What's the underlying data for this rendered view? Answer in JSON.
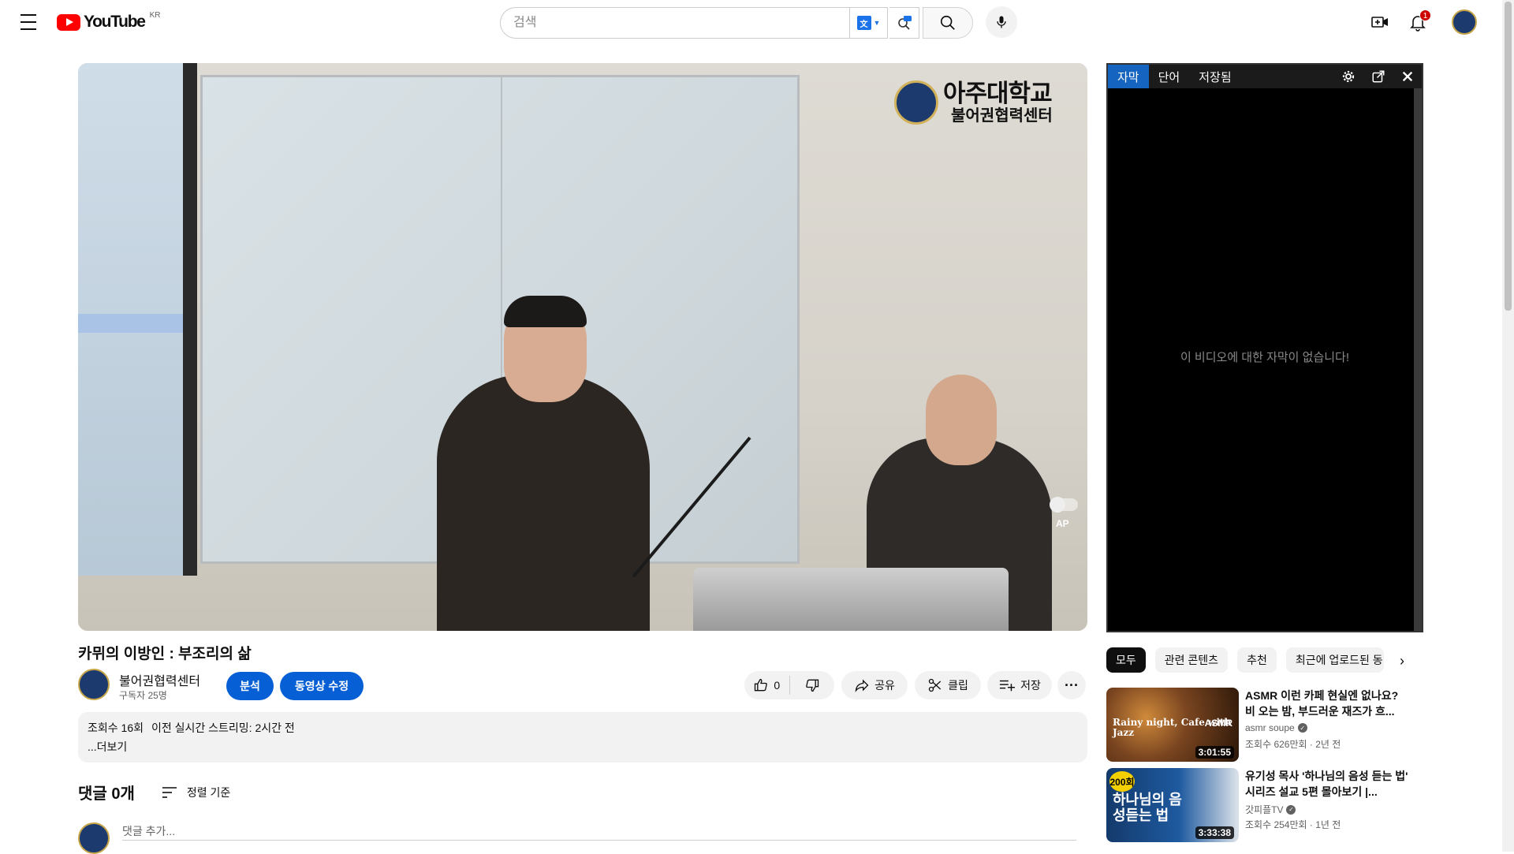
{
  "header": {
    "logo_text": "YouTube",
    "region": "KR",
    "search_placeholder": "검색",
    "notification_count": "1"
  },
  "player": {
    "brand_line1": "아주대학교",
    "brand_line2": "불어권협력센터",
    "autoplay_label": "AP"
  },
  "video": {
    "title": "카뮈의 이방인 : 부조리의 삶",
    "channel_name": "불어권협력센터",
    "subscribers": "구독자 25명",
    "analytics_label": "분석",
    "edit_label": "동영상 수정",
    "like_count": "0",
    "share_label": "공유",
    "clip_label": "클립",
    "save_label": "저장",
    "views": "조회수 16회",
    "stream_info": "이전 실시간 스트리밍: 2시간 전",
    "more_label": "...더보기"
  },
  "comments": {
    "count_label": "댓글 0개",
    "sort_label": "정렬 기준",
    "add_placeholder": "댓글 추가..."
  },
  "subtitle_panel": {
    "tabs": [
      "자막",
      "단어",
      "저장됨"
    ],
    "empty_message": "이 비디오에 대한 자막이 없습니다!"
  },
  "chips": [
    "모두",
    "관련 콘텐츠",
    "추천",
    "최근에 업로드된 동"
  ],
  "related": [
    {
      "title": "ASMR 이런 카페 현실엔 없나요? 비 오는 밤, 부드러운 재즈가 흐...",
      "channel": "asmr soupe",
      "meta": "조회수 626만회 · 2년 전",
      "duration": "3:01:55",
      "thumb_text": "Rainy night, Cafe with Jazz",
      "thumb_tag": "ASMR"
    },
    {
      "title": "유기성 목사 '하나님의 음성 듣는 법' 시리즈 설교 5편 몰아보기 |...",
      "channel": "갓피플TV",
      "meta": "조회수 254만회 · 1년 전",
      "duration": "3:33:38",
      "thumb_badge": "200회",
      "thumb_text": "하나님의 음성듣는 법"
    }
  ]
}
